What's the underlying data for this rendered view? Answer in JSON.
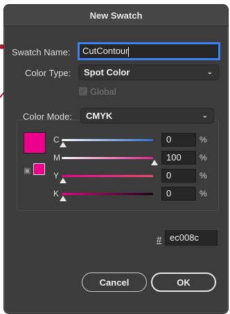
{
  "dialog": {
    "title": "New Swatch"
  },
  "swatch_name": {
    "label": "Swatch Name:",
    "value": "CutContour"
  },
  "color_type": {
    "label": "Color Type:",
    "value": "Spot Color"
  },
  "global": {
    "label": "Global",
    "checked": true
  },
  "color_mode": {
    "label": "Color Mode:",
    "value": "CMYK"
  },
  "swatch_color": "#ec008c",
  "channels": [
    {
      "label": "C",
      "value": "0",
      "unit": "%"
    },
    {
      "label": "M",
      "value": "100",
      "unit": "%"
    },
    {
      "label": "Y",
      "value": "0",
      "unit": "%"
    },
    {
      "label": "K",
      "value": "0",
      "unit": "%"
    }
  ],
  "hex": {
    "label": "#",
    "value": "ec008c"
  },
  "buttons": {
    "cancel": "Cancel",
    "ok": "OK"
  },
  "colors": {
    "annotation_red": "#b01c2e",
    "focus_blue": "#3b82f6"
  }
}
